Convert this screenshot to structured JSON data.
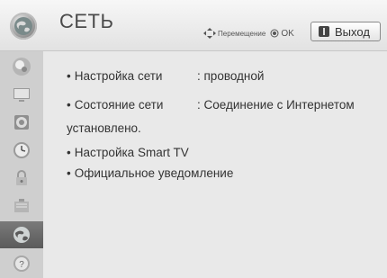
{
  "header": {
    "title": "СЕТЬ",
    "hint_move": "Перемещение",
    "hint_ok": "OK",
    "exit_label": "Выход"
  },
  "sidebar": {
    "items": [
      {
        "name": "picture",
        "icon": "picture-icon"
      },
      {
        "name": "display",
        "icon": "monitor-icon"
      },
      {
        "name": "audio",
        "icon": "speaker-icon"
      },
      {
        "name": "time",
        "icon": "clock-icon"
      },
      {
        "name": "lock",
        "icon": "lock-icon"
      },
      {
        "name": "options",
        "icon": "options-icon"
      },
      {
        "name": "network",
        "icon": "globe-icon",
        "active": true
      },
      {
        "name": "support",
        "icon": "help-icon"
      }
    ]
  },
  "content": {
    "items": [
      {
        "label": "Настройка сети",
        "value": ": проводной"
      },
      {
        "label": "Состояние сети",
        "value": ": Соединение с Интернетом",
        "continuation": "установлено."
      },
      {
        "label": "Настройка Smart TV"
      },
      {
        "label": "Официальное уведомление"
      }
    ],
    "bullet": "•"
  },
  "colors": {
    "header_bg": "#e8e8e8",
    "sidebar_bg": "#cfcfcf",
    "active_item": "#5e5e5e",
    "content_bg": "#e9e9e9",
    "text": "#333333"
  }
}
